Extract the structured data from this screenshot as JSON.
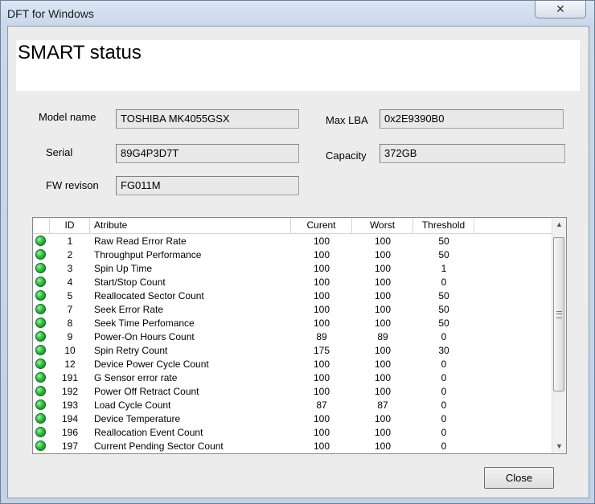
{
  "window": {
    "title": "DFT for Windows"
  },
  "header": {
    "title": "SMART status"
  },
  "info": {
    "model_label": "Model name",
    "model_value": "TOSHIBA MK4055GSX",
    "serial_label": "Serial",
    "serial_value": "89G4P3D7T",
    "fw_label": "FW revison",
    "fw_value": "FG011M",
    "maxlba_label": "Max LBA",
    "maxlba_value": "0x2E9390B0",
    "capacity_label": "Capacity",
    "capacity_value": "372GB"
  },
  "table": {
    "columns": [
      "ID",
      "Atribute",
      "Curent",
      "Worst",
      "Threshold"
    ],
    "status_color": "#2dbb3f",
    "rows": [
      {
        "id": "1",
        "attr": "Raw Read Error Rate",
        "cur": "100",
        "worst": "100",
        "thr": "50"
      },
      {
        "id": "2",
        "attr": "Throughput Performance",
        "cur": "100",
        "worst": "100",
        "thr": "50"
      },
      {
        "id": "3",
        "attr": "Spin Up Time",
        "cur": "100",
        "worst": "100",
        "thr": "1"
      },
      {
        "id": "4",
        "attr": "Start/Stop Count",
        "cur": "100",
        "worst": "100",
        "thr": "0"
      },
      {
        "id": "5",
        "attr": "Reallocated Sector Count",
        "cur": "100",
        "worst": "100",
        "thr": "50"
      },
      {
        "id": "7",
        "attr": "Seek Error Rate",
        "cur": "100",
        "worst": "100",
        "thr": "50"
      },
      {
        "id": "8",
        "attr": "Seek Time Perfomance",
        "cur": "100",
        "worst": "100",
        "thr": "50"
      },
      {
        "id": "9",
        "attr": "Power-On Hours Count",
        "cur": "89",
        "worst": "89",
        "thr": "0"
      },
      {
        "id": "10",
        "attr": "Spin Retry Count",
        "cur": "175",
        "worst": "100",
        "thr": "30"
      },
      {
        "id": "12",
        "attr": "Device Power Cycle Count",
        "cur": "100",
        "worst": "100",
        "thr": "0"
      },
      {
        "id": "191",
        "attr": "G Sensor error rate",
        "cur": "100",
        "worst": "100",
        "thr": "0"
      },
      {
        "id": "192",
        "attr": "Power Off Retract Count",
        "cur": "100",
        "worst": "100",
        "thr": "0"
      },
      {
        "id": "193",
        "attr": "Load Cycle Count",
        "cur": "87",
        "worst": "87",
        "thr": "0"
      },
      {
        "id": "194",
        "attr": "Device Temperature",
        "cur": "100",
        "worst": "100",
        "thr": "0"
      },
      {
        "id": "196",
        "attr": "Reallocation Event Count",
        "cur": "100",
        "worst": "100",
        "thr": "0"
      },
      {
        "id": "197",
        "attr": "Current Pending Sector Count",
        "cur": "100",
        "worst": "100",
        "thr": "0"
      }
    ]
  },
  "buttons": {
    "close_label": "Close"
  }
}
